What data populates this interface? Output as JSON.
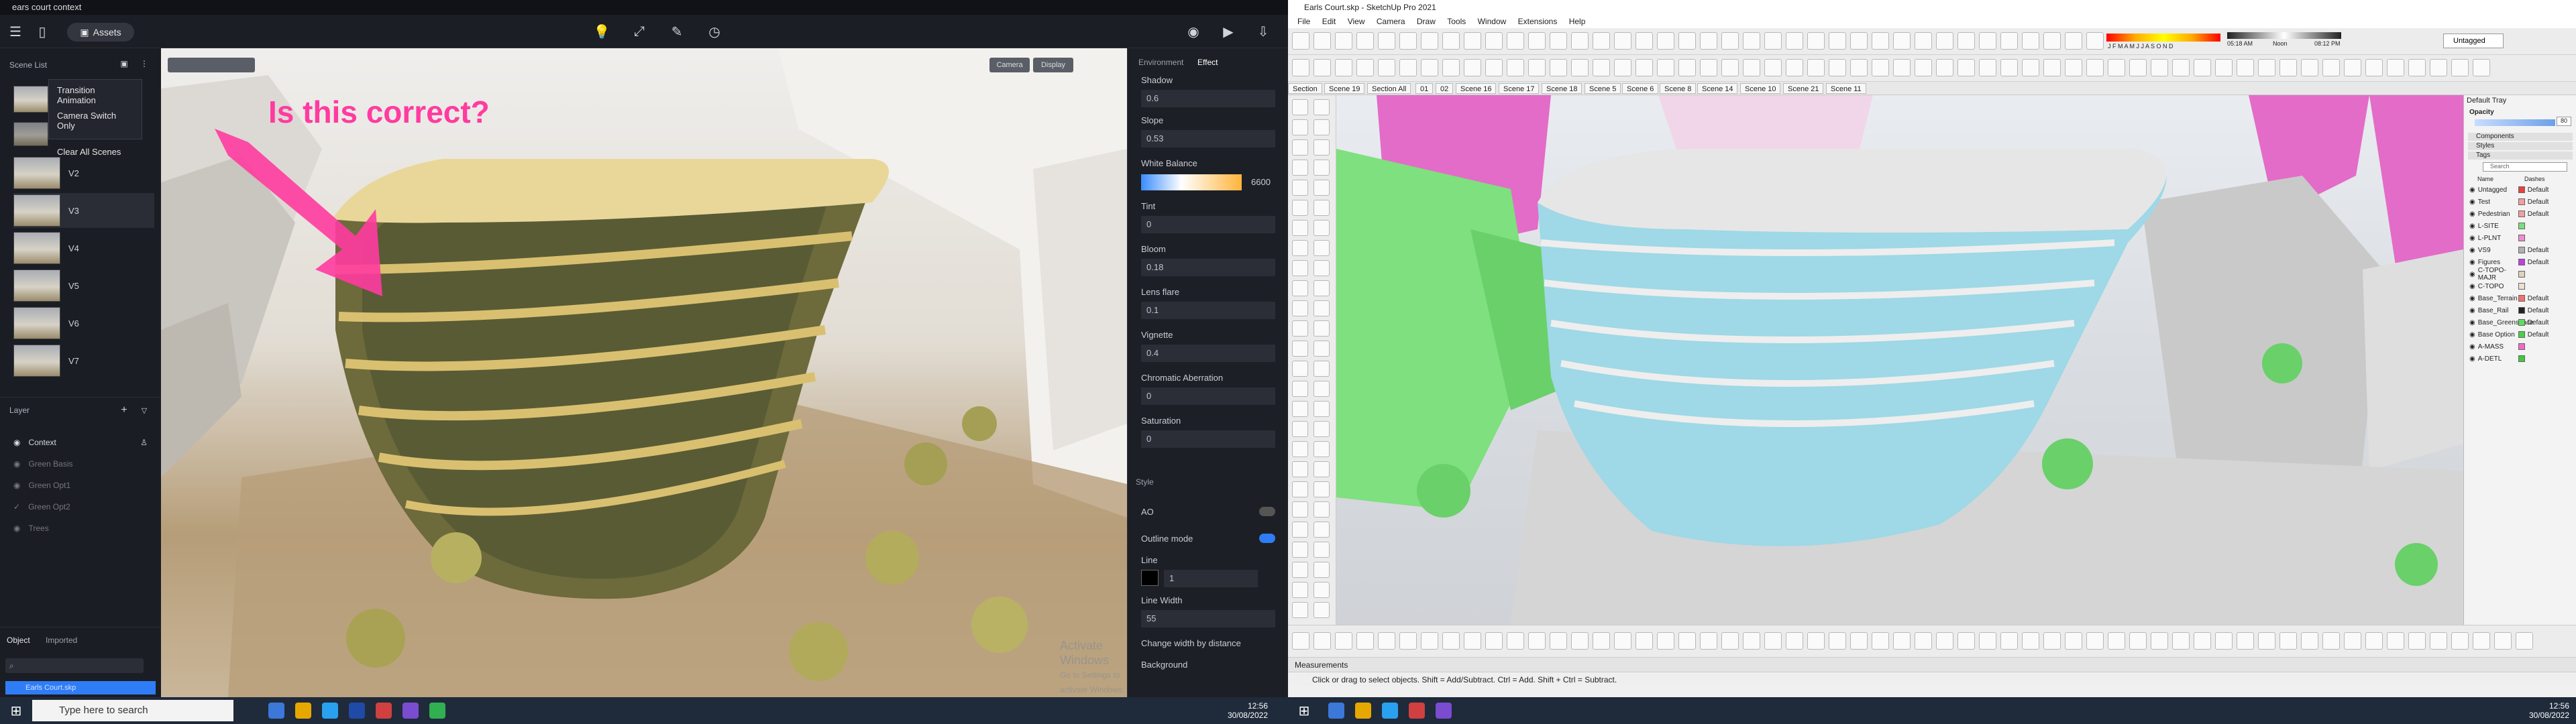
{
  "d5": {
    "title": "ears court context",
    "assets_label": "Assets",
    "scene_list_label": "Scene List",
    "context_menu": [
      "Transition Animation",
      "Camera Switch Only",
      "Clear All Scenes"
    ],
    "scenes": [
      "V2",
      "V3",
      "V4",
      "V5",
      "V6",
      "V7"
    ],
    "layer_label": "Layer",
    "layers": [
      "Context",
      "Green Basis",
      "Green Opt1",
      "Green Opt2",
      "Trees"
    ],
    "object_tab": "Object",
    "imported_tab": "Imported",
    "object_item": "Earls Court.skp",
    "annotation": "Is this correct?",
    "viewport_buttons": [
      "Camera",
      "Display"
    ],
    "panel_tabs": [
      "Environment",
      "Effect"
    ],
    "params": [
      {
        "label": "Shadow",
        "value": ""
      },
      {
        "label": "",
        "value": "0.6"
      },
      {
        "label": "Slope",
        "value": "0.53"
      },
      {
        "label": "White Balance",
        "value": "6600"
      },
      {
        "label": "Tint",
        "value": "0"
      },
      {
        "label": "Bloom",
        "value": "0.18"
      },
      {
        "label": "Lens flare",
        "value": "0.1"
      },
      {
        "label": "Vignette",
        "value": "0.4"
      },
      {
        "label": "Chromatic Aberration",
        "value": "0"
      },
      {
        "label": "Saturation",
        "value": "0"
      }
    ],
    "style_label": "Style",
    "ao_label": "AO",
    "outline_label": "Outline mode",
    "line_label": "Line",
    "line_value": "1",
    "line_width_label": "Line Width",
    "line_width_value": "55",
    "change_width_label": "Change width by distance",
    "background_label": "Background",
    "watermark_1": "Activate Windows",
    "watermark_2": "Go to Settings to activate Windows."
  },
  "taskbar": {
    "search_placeholder": "Type here to search",
    "time": "12:56",
    "date": "30/08/2022"
  },
  "sketchup": {
    "title": "Earls Court.skp - SketchUp Pro 2021",
    "menu": [
      "File",
      "Edit",
      "View",
      "Camera",
      "Draw",
      "Tools",
      "Window",
      "Extensions",
      "Help"
    ],
    "untagged_dropdown": "Untagged",
    "scene_tabs": [
      "Section",
      "Scene 19",
      "Section All",
      "01",
      "02",
      "Scene 16",
      "Scene 17",
      "Scene 18",
      "Scene 5",
      "Scene 6",
      "Scene 8",
      "Scene 14",
      "Scene 10",
      "Scene 21",
      "Scene 11"
    ],
    "tray_title": "Default Tray",
    "opacity_label": "Opacity",
    "opacity_value": "80",
    "sections": [
      "Components",
      "Styles",
      "Tags"
    ],
    "search_placeholder": "Search",
    "tags_header": {
      "name": "Name",
      "dashes": "Dashes"
    },
    "tags": [
      {
        "name": "Untagged",
        "dashes": "Default",
        "color": "#e84040"
      },
      {
        "name": "Test",
        "dashes": "Default",
        "color": "#f0a0a0"
      },
      {
        "name": "Pedestrian",
        "dashes": "Default",
        "color": "#f0a0a0"
      },
      {
        "name": "L-SITE",
        "dashes": "",
        "color": "#7ddc7d"
      },
      {
        "name": "L-PLNT",
        "dashes": "",
        "color": "#f08cd0"
      },
      {
        "name": "VS9",
        "dashes": "Default",
        "color": "#b0b0b0"
      },
      {
        "name": "Figures",
        "dashes": "Default",
        "color": "#c040e0"
      },
      {
        "name": "C-TOPO-MAJR",
        "dashes": "",
        "color": "#e0d0c0"
      },
      {
        "name": "C-TOPO",
        "dashes": "",
        "color": "#ece0d4"
      },
      {
        "name": "Base_Terrain",
        "dashes": "Default",
        "color": "#f27070"
      },
      {
        "name": "Base_Rail",
        "dashes": "Default",
        "color": "#222222"
      },
      {
        "name": "Base_Greenspace",
        "dashes": "Default",
        "color": "#5ce05c"
      },
      {
        "name": "Base Option",
        "dashes": "Default",
        "color": "#48d048"
      },
      {
        "name": "A-MASS",
        "dashes": "",
        "color": "#f06ac8"
      },
      {
        "name": "A-DETL",
        "dashes": "",
        "color": "#40c840"
      }
    ],
    "measurements_label": "Measurements",
    "status": "Click or drag to select objects. Shift = Add/Subtract. Ctrl = Add. Shift + Ctrl = Subtract.",
    "shadow_time_start": "05:18 AM",
    "shadow_noon": "Noon",
    "shadow_time_end": "08:12 PM",
    "months": "J F M A M J J A S O N D"
  },
  "colors": {
    "accent": "#2f7df6",
    "annotation": "#ff3ba0",
    "mass_pink": "#e36cc8",
    "green": "#7ee07e",
    "glass": "#9fd8e6"
  }
}
